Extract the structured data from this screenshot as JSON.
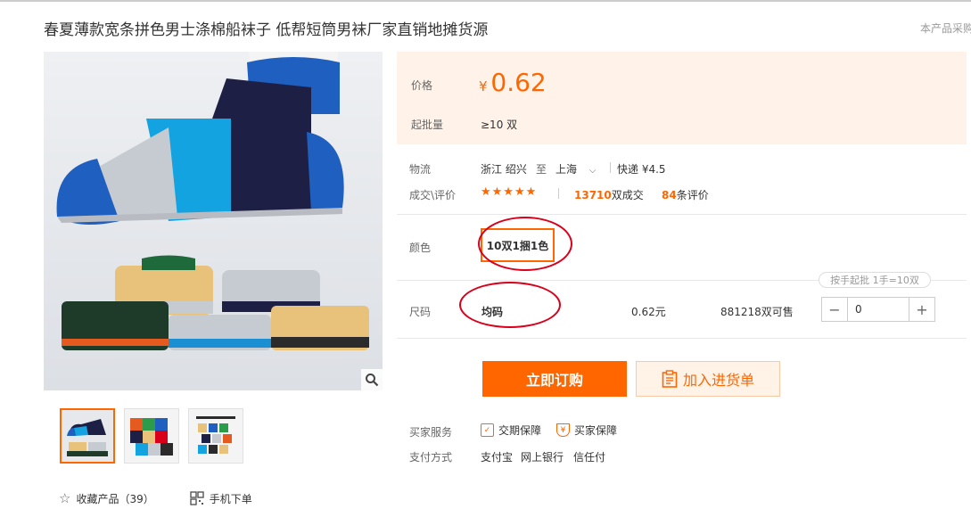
{
  "product": {
    "title": "春夏薄款宽条拼色男士涤棉船袜子 低帮短筒男袜厂家直销地摊货源",
    "report_link": "本产品采购"
  },
  "price": {
    "label": "价格",
    "currency": "¥",
    "value": "0.62",
    "moq_label": "起批量",
    "moq_value": "≥10 双"
  },
  "logistics": {
    "label": "物流",
    "from": "浙江 绍兴",
    "to_word": "至",
    "to": "上海",
    "shipping": "快递 ¥4.5"
  },
  "deals": {
    "label": "成交\\评价",
    "rating": 4.5,
    "stars": "★★★★★",
    "sold_count": "13710",
    "sold_unit": "双成交",
    "review_count": "84",
    "review_unit": "条评价"
  },
  "color": {
    "label": "颜色",
    "option": "10双1捆1色"
  },
  "size": {
    "label": "尺码",
    "hint": "按手起批 1手=10双",
    "option": "均码",
    "price": "0.62元",
    "stock": "881218双可售",
    "quantity": "0",
    "minus": "−",
    "plus": "+"
  },
  "actions": {
    "buy": "立即订购",
    "cart": "加入进货单"
  },
  "services": {
    "label": "买家服务",
    "items": [
      "交期保障",
      "买家保障"
    ],
    "payment_label": "支付方式",
    "payments": [
      "支付宝",
      "网上银行",
      "信任付"
    ]
  },
  "bottom": {
    "favorite": "收藏产品（39）",
    "mobile": "手机下单"
  },
  "colors": {
    "accent": "#ff6600",
    "price_bg": "#fff2e8",
    "annotation": "#d9001b"
  }
}
